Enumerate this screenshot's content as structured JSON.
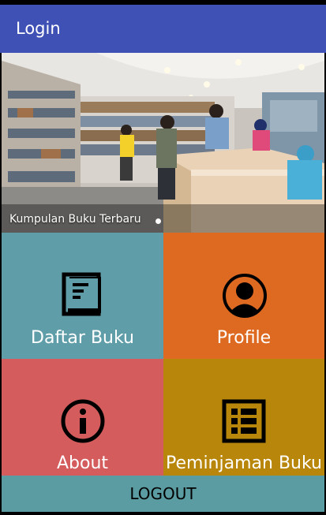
{
  "appbar": {
    "title": "Login"
  },
  "banner": {
    "caption": "Kumpulan Buku Terbaru"
  },
  "menu": {
    "daftar_buku": "Daftar Buku",
    "profile": "Profile",
    "about": "About",
    "peminjaman": "Peminjaman Buku"
  },
  "logout_label": "LOGOUT",
  "colors": {
    "appbar": "#3f51b5",
    "daftar_buku": "#5f9ea8",
    "profile": "#de6a22",
    "about": "#d45c5c",
    "peminjaman": "#b8860b",
    "logout": "#5b9ca2"
  },
  "icons": [
    "book-icon",
    "user-icon",
    "info-icon",
    "list-icon"
  ]
}
